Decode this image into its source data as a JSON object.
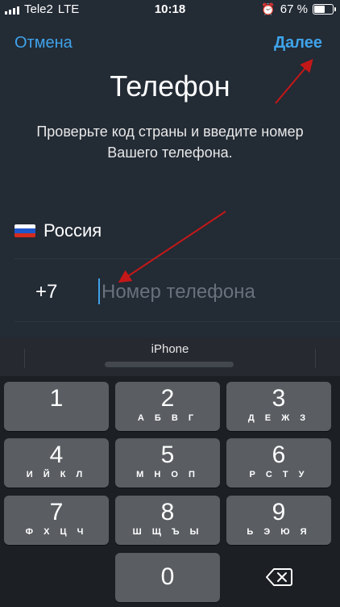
{
  "status_bar": {
    "carrier": "Tele2",
    "network": "LTE",
    "time": "10:18",
    "battery_percent": "67 %",
    "battery_level": 0.67,
    "icons": [
      "signal-icon",
      "alarm-icon",
      "battery-icon"
    ]
  },
  "nav": {
    "cancel_label": "Отмена",
    "next_label": "Далее"
  },
  "header": {
    "title": "Телефон",
    "subtitle": "Проверьте код страны и введите номер Вашего телефона."
  },
  "country": {
    "name": "Россия",
    "flag_colors": [
      "#ffffff",
      "#1f56c9",
      "#d52b1e"
    ]
  },
  "phone": {
    "country_code": "+7",
    "value": "",
    "placeholder": "Номер телефона"
  },
  "keyboard": {
    "suggestion": "iPhone",
    "keys": [
      {
        "digit": "1",
        "letters": ""
      },
      {
        "digit": "2",
        "letters": "А Б В Г"
      },
      {
        "digit": "3",
        "letters": "Д Е Ж З"
      },
      {
        "digit": "4",
        "letters": "И Й К Л"
      },
      {
        "digit": "5",
        "letters": "М Н О П"
      },
      {
        "digit": "6",
        "letters": "Р С Т У"
      },
      {
        "digit": "7",
        "letters": "Ф Х Ц Ч"
      },
      {
        "digit": "8",
        "letters": "Ш Щ Ъ Ы"
      },
      {
        "digit": "9",
        "letters": "Ь Э Ю Я"
      },
      {
        "digit": "0",
        "letters": ""
      }
    ],
    "backspace_icon": "backspace-icon"
  },
  "colors": {
    "accent": "#3fa3ea",
    "background": "#232b35",
    "annotation_arrow": "#c41818"
  }
}
